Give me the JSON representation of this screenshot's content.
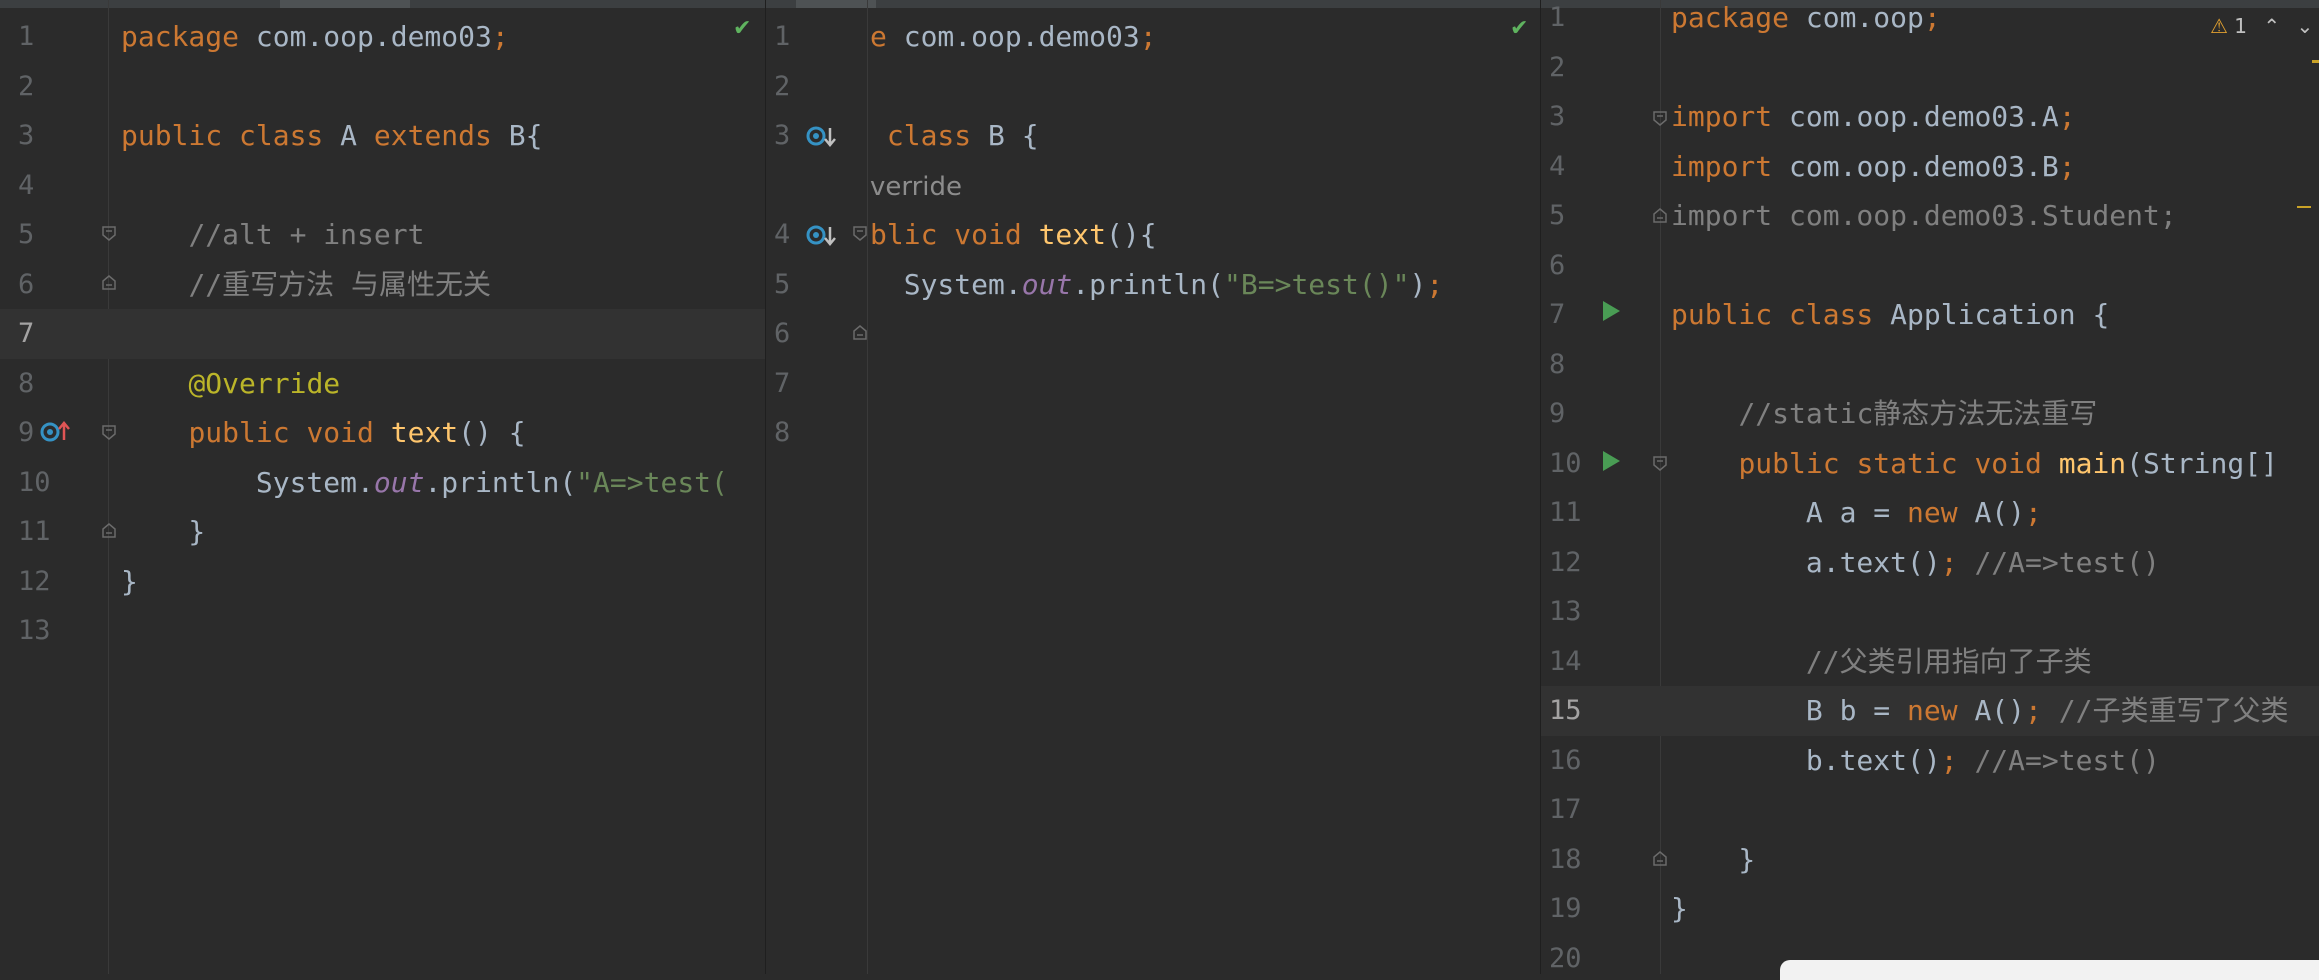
{
  "pane_a": {
    "file": "A.java",
    "lines": [
      {
        "n": "1",
        "tokens": [
          [
            "kw",
            "package "
          ],
          [
            "",
            "com.oop.demo03"
          ],
          [
            "kw",
            ";"
          ]
        ]
      },
      {
        "n": "2",
        "tokens": []
      },
      {
        "n": "3",
        "tokens": [
          [
            "kw",
            "public class "
          ],
          [
            "",
            "A "
          ],
          [
            "kw",
            "extends "
          ],
          [
            "",
            "B{"
          ]
        ]
      },
      {
        "n": "4",
        "tokens": []
      },
      {
        "n": "5",
        "tokens": [
          [
            "",
            "    "
          ],
          [
            "cm",
            "//alt + insert"
          ]
        ]
      },
      {
        "n": "6",
        "tokens": [
          [
            "",
            "    "
          ],
          [
            "cm",
            "//重写方法 与属性无关"
          ]
        ]
      },
      {
        "n": "7",
        "tokens": []
      },
      {
        "n": "8",
        "tokens": [
          [
            "",
            "    "
          ],
          [
            "an",
            "@Override"
          ]
        ]
      },
      {
        "n": "9",
        "tokens": [
          [
            "",
            "    "
          ],
          [
            "kw",
            "public void "
          ],
          [
            "fn",
            "text"
          ],
          [
            "",
            "() {"
          ]
        ]
      },
      {
        "n": "10",
        "tokens": [
          [
            "",
            "        System."
          ],
          [
            "it",
            "out"
          ],
          [
            "",
            ".println("
          ],
          [
            "st",
            "\"A=>test("
          ]
        ]
      },
      {
        "n": "11",
        "tokens": [
          [
            "",
            "    }"
          ]
        ]
      },
      {
        "n": "12",
        "tokens": [
          [
            "",
            "}"
          ]
        ]
      },
      {
        "n": "13",
        "tokens": []
      }
    ]
  },
  "pane_b": {
    "file": "B.java",
    "lines": [
      {
        "n": "1",
        "tokens": [
          [
            "kw",
            "e "
          ],
          [
            "",
            "com.oop.demo03"
          ],
          [
            "kw",
            ";"
          ]
        ]
      },
      {
        "n": "2",
        "tokens": []
      },
      {
        "n": "3",
        "tokens": [
          [
            "kw",
            " class "
          ],
          [
            "",
            "B {"
          ]
        ]
      },
      {
        "n": "",
        "tokens": [
          [
            "hint",
            "verride"
          ]
        ]
      },
      {
        "n": "4",
        "tokens": [
          [
            "kw",
            "blic void "
          ],
          [
            "fn",
            "text"
          ],
          [
            "",
            "(){"
          ]
        ]
      },
      {
        "n": "5",
        "tokens": [
          [
            "",
            "  System."
          ],
          [
            "it",
            "out"
          ],
          [
            "",
            ".println("
          ],
          [
            "st",
            "\"B=>test()\""
          ],
          [
            "",
            ")"
          ],
          [
            "kw",
            ";"
          ]
        ]
      },
      {
        "n": "6",
        "tokens": []
      },
      {
        "n": "7",
        "tokens": []
      },
      {
        "n": "8",
        "tokens": []
      }
    ]
  },
  "pane_c": {
    "file": "Application.java",
    "warning_count": "1",
    "lines": [
      {
        "n": "1",
        "tokens": [
          [
            "kw",
            "package "
          ],
          [
            "",
            "com.oop"
          ],
          [
            "kw",
            ";"
          ]
        ]
      },
      {
        "n": "2",
        "tokens": []
      },
      {
        "n": "3",
        "tokens": [
          [
            "kw",
            "import "
          ],
          [
            "",
            "com.oop.demo03.A"
          ],
          [
            "kw",
            ";"
          ]
        ]
      },
      {
        "n": "4",
        "tokens": [
          [
            "kw",
            "import "
          ],
          [
            "",
            "com.oop.demo03.B"
          ],
          [
            "kw",
            ";"
          ]
        ]
      },
      {
        "n": "5",
        "tokens": [
          [
            "cm",
            "import com.oop.demo03.Student;"
          ]
        ]
      },
      {
        "n": "6",
        "tokens": []
      },
      {
        "n": "7",
        "tokens": [
          [
            "kw",
            "public class "
          ],
          [
            "",
            "Application {"
          ]
        ]
      },
      {
        "n": "8",
        "tokens": []
      },
      {
        "n": "9",
        "tokens": [
          [
            "",
            "    "
          ],
          [
            "cm",
            "//static静态方法无法重写"
          ]
        ]
      },
      {
        "n": "10",
        "tokens": [
          [
            "",
            "    "
          ],
          [
            "kw",
            "public static void "
          ],
          [
            "fn",
            "main"
          ],
          [
            "",
            "(String[]"
          ]
        ]
      },
      {
        "n": "11",
        "tokens": [
          [
            "",
            "        A a = "
          ],
          [
            "kw",
            "new "
          ],
          [
            "",
            "A()"
          ],
          [
            "kw",
            ";"
          ]
        ]
      },
      {
        "n": "12",
        "tokens": [
          [
            "",
            "        a.text()"
          ],
          [
            "kw",
            "; "
          ],
          [
            "cm",
            "//A=>test()"
          ]
        ]
      },
      {
        "n": "13",
        "tokens": []
      },
      {
        "n": "14",
        "tokens": [
          [
            "",
            "        "
          ],
          [
            "cm",
            "//父类引用指向了子类"
          ]
        ]
      },
      {
        "n": "15",
        "tokens": [
          [
            "",
            "        B b = "
          ],
          [
            "kw",
            "new "
          ],
          [
            "",
            "A()"
          ],
          [
            "kw",
            "; "
          ],
          [
            "cm",
            "//子类重写了父类"
          ]
        ]
      },
      {
        "n": "16",
        "tokens": [
          [
            "",
            "        b.text()"
          ],
          [
            "kw",
            "; "
          ],
          [
            "cm",
            "//A=>test()"
          ]
        ]
      },
      {
        "n": "17",
        "tokens": []
      },
      {
        "n": "18",
        "tokens": [
          [
            "",
            "    }"
          ]
        ]
      },
      {
        "n": "19",
        "tokens": [
          [
            "",
            "}"
          ]
        ]
      },
      {
        "n": "20",
        "tokens": []
      }
    ]
  },
  "icons": {
    "check": "inspection-ok-icon",
    "run": "run-gutter-icon",
    "override": "override-marker-icon",
    "implemented": "implemented-marker-icon",
    "warning": "warning-icon",
    "fold": "fold-icon"
  },
  "colors": {
    "background": "#2b2b2b",
    "keyword": "#cc7832",
    "comment": "#808080",
    "string": "#6a8759",
    "annotation": "#bbb529",
    "method": "#ffc66d",
    "static_field": "#9876aa",
    "text": "#a9b7c6"
  }
}
